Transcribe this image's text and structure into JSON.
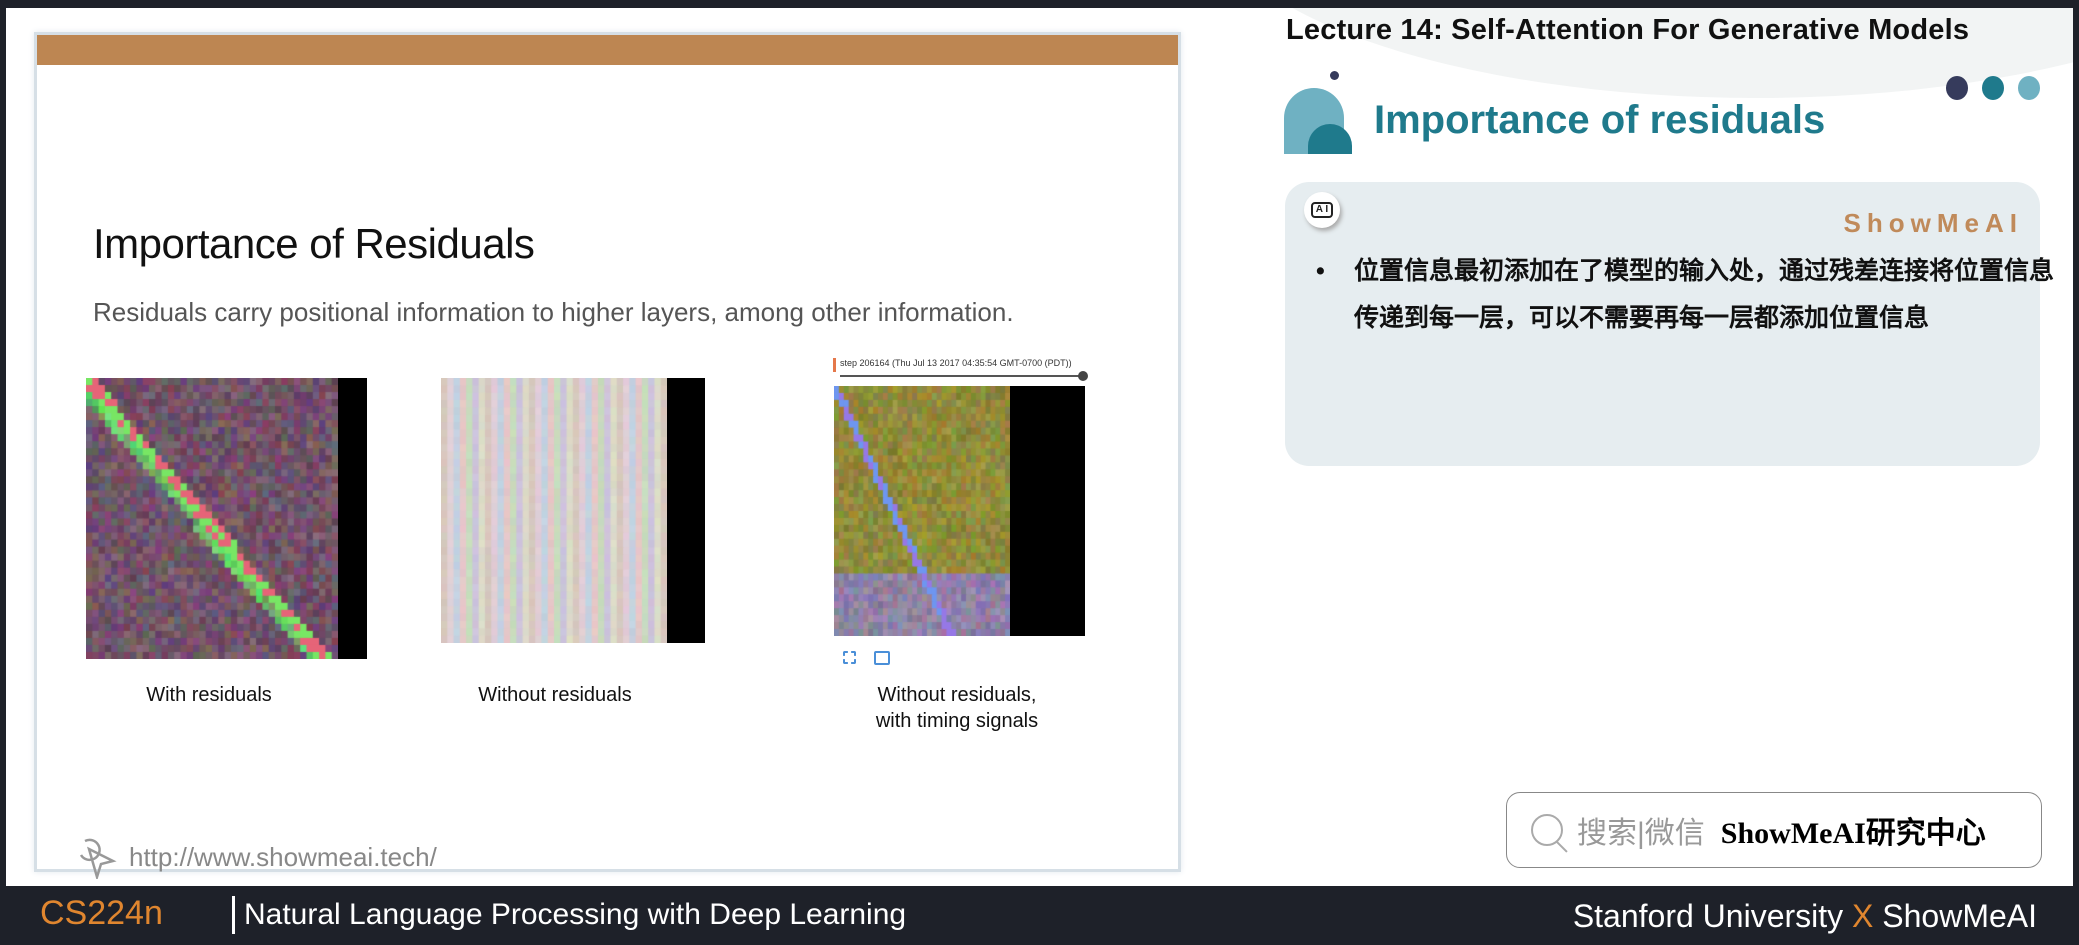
{
  "slide": {
    "title": "Importance of Residuals",
    "subtitle": "Residuals carry positional information to higher layers, among other information.",
    "figures": [
      {
        "caption": "With residuals"
      },
      {
        "caption": "Without residuals"
      },
      {
        "caption_line1": "Without residuals,",
        "caption_line2": "with timing signals",
        "step_label": "step 206164 (Thu Jul 13 2017 04:35:54 GMT-0700 (PDT))"
      }
    ],
    "url": "http://www.showmeai.tech/",
    "accent_bar_color": "#bd8652"
  },
  "panel": {
    "lecture_title": "Lecture 14:  Self-Attention For Generative Models",
    "heading": "Importance of residuals",
    "brand": "ShowMeAI",
    "ai_icon_label": "A I",
    "bullet": "位置信息最初添加在了模型的输入处，通过残差连接将位置信息传递到每一层，可以不需要再每一层都添加位置信息",
    "dots": [
      "#363b5c",
      "#1f7a8c",
      "#6fb1c2"
    ],
    "heading_color": "#1f7a8c"
  },
  "search": {
    "gray_text": "搜索|微信",
    "bold_text": "ShowMeAI研究中心"
  },
  "footer": {
    "course": "CS224n",
    "course_name": "Natural Language Processing with Deep Learning",
    "credit_left": "Stanford University",
    "credit_x": "X",
    "credit_right": "ShowMeAI"
  }
}
